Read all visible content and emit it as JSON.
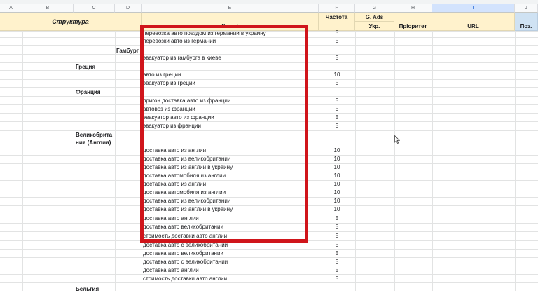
{
  "column_letters": [
    "A",
    "B",
    "C",
    "D",
    "E",
    "F",
    "G",
    "H",
    "I",
    "J"
  ],
  "selected_column": "I",
  "header": {
    "structure": "Структура",
    "keys": "Ключі",
    "frequency": "Частота",
    "gads": "G. Ads",
    "ukr": "Укр.",
    "priority": "Пріоритет",
    "url": "URL",
    "pos": "Поз."
  },
  "labels": {
    "hamburg": "Гамбург",
    "greece": "Греция",
    "france": "Франция",
    "uk_line1": "Великобрита",
    "uk_line2": "ния (Англия)",
    "belgium": "Бельгия"
  },
  "rows": [
    {
      "keyword": "перевозка авто поездом из германии в украину",
      "freq": "5"
    },
    {
      "keyword": "перевозки авто из германии",
      "freq": "5"
    },
    {
      "keyword": "эвакуатор из гамбурга в киеве",
      "freq": "5"
    },
    {
      "keyword": "авто из греции",
      "freq": "10"
    },
    {
      "keyword": "эвакуатор из греции",
      "freq": "5"
    },
    {
      "keyword": "пригон доставка авто из франции",
      "freq": "5"
    },
    {
      "keyword": "автовоз из франции",
      "freq": "5"
    },
    {
      "keyword": "эвакуатор авто из франции",
      "freq": "5"
    },
    {
      "keyword": "эвакуатор из франции",
      "freq": "5"
    },
    {
      "keyword": "доставка авто из англии",
      "freq": "10"
    },
    {
      "keyword": "доставка авто из великобритании",
      "freq": "10"
    },
    {
      "keyword": "доставка авто из англии в украину",
      "freq": "10"
    },
    {
      "keyword": "доставка автомобиля из англии",
      "freq": "10"
    },
    {
      "keyword": "доставка авто из англии",
      "freq": "10"
    },
    {
      "keyword": "доставка автомобиля из англии",
      "freq": "10"
    },
    {
      "keyword": "доставка авто из великобритании",
      "freq": "10"
    },
    {
      "keyword": "доставка авто из англии в украину",
      "freq": "10"
    },
    {
      "keyword": "доставка авто англии",
      "freq": "5"
    },
    {
      "keyword": "доставка авто великобритании",
      "freq": "5"
    },
    {
      "keyword": "стоимость доставки авто англии",
      "freq": "5"
    },
    {
      "keyword": "доставка авто с великобритании",
      "freq": "5"
    },
    {
      "keyword": "доставка авто великобритании",
      "freq": "5"
    },
    {
      "keyword": "доставка авто с великобритании",
      "freq": "5"
    },
    {
      "keyword": "доставка авто англии",
      "freq": "5"
    },
    {
      "keyword": "стоимость доставки авто англии",
      "freq": "5"
    }
  ],
  "colors": {
    "highlight_border": "#d0151b",
    "header_fill": "#fff2cc",
    "header_blue": "#cfe2f3"
  }
}
